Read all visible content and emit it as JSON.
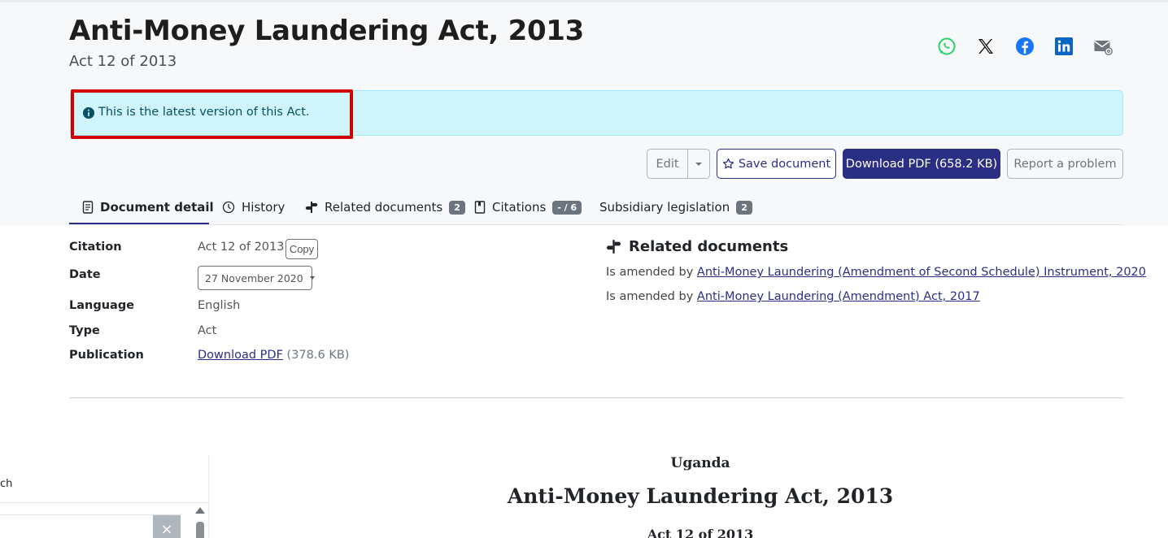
{
  "header": {
    "title": "Anti-Money Laundering Act, 2013",
    "subtitle": "Act 12 of 2013"
  },
  "share": {
    "icons": [
      "whatsapp-icon",
      "x-icon",
      "facebook-icon",
      "linkedin-icon",
      "email-icon"
    ],
    "colors": {
      "whatsapp": "#25d366",
      "x": "#111111",
      "facebook": "#1877f2",
      "linkedin": "#0a66c2",
      "email": "#6c757d"
    }
  },
  "alert": {
    "text": "This is the latest version of this Act.",
    "highlight_color": "#d40000"
  },
  "actions": {
    "edit": "Edit",
    "save": "Save document",
    "download": "Download PDF (658.2 KB)",
    "report": "Report a problem"
  },
  "tabs": [
    {
      "label": "Document detail",
      "active": true
    },
    {
      "label": "History"
    },
    {
      "label": "Related documents",
      "badge": "2"
    },
    {
      "label": "Citations",
      "badge": "- / 6"
    },
    {
      "label": "Subsidiary legislation",
      "badge": "2"
    }
  ],
  "details": {
    "citation_label": "Citation",
    "citation_value": "Act 12 of 2013",
    "copy_label": "Copy",
    "date_label": "Date",
    "date_value": "27 November 2020",
    "language_label": "Language",
    "language_value": "English",
    "type_label": "Type",
    "type_value": "Act",
    "publication_label": "Publication",
    "publication_link": "Download PDF",
    "publication_size": "(378.6 KB)"
  },
  "related": {
    "title": "Related documents",
    "items": [
      {
        "prefix": "Is amended by",
        "link": "Anti-Money Laundering (Amendment of Second Schedule) Instrument, 2020"
      },
      {
        "prefix": "Is amended by",
        "link": "Anti-Money Laundering (Amendment) Act, 2017"
      }
    ]
  },
  "sidebar": {
    "text": "ch",
    "clear": "×"
  },
  "body": {
    "country": "Uganda",
    "title": "Anti-Money Laundering Act, 2013",
    "subtitle": "Act 12 of 2013"
  },
  "colors": {
    "primary": "#2b2f83",
    "alert_bg": "#cff4fc",
    "badge_bg": "#6c757d"
  }
}
